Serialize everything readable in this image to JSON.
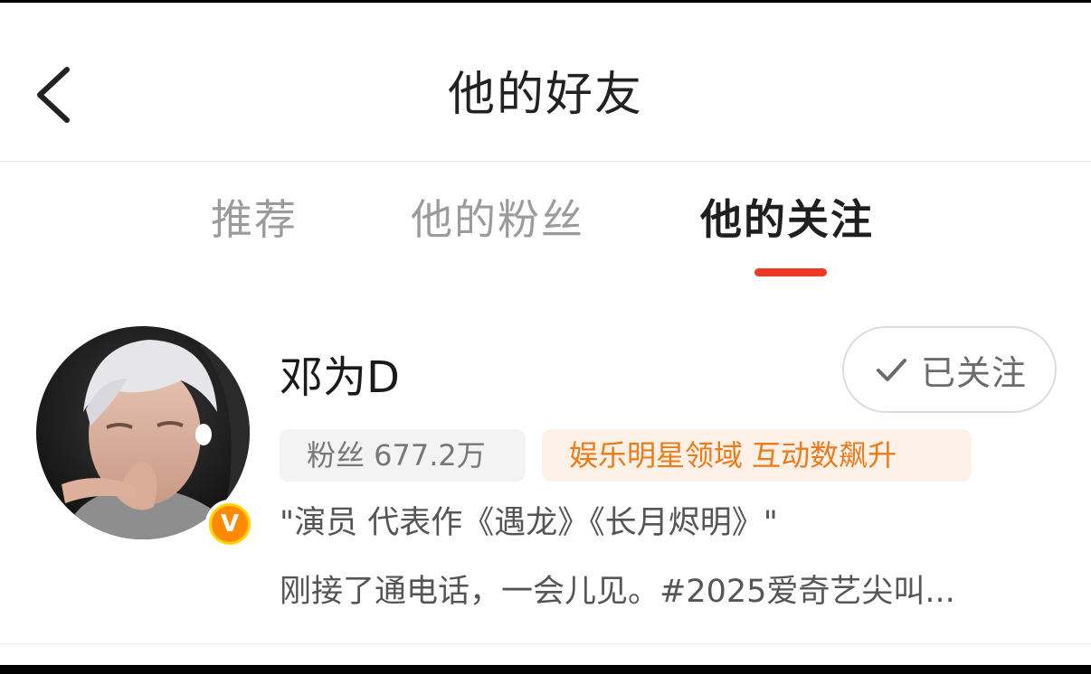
{
  "header": {
    "title": "他的好友",
    "back_icon": "chevron-left-icon"
  },
  "tabs": [
    {
      "label": "推荐",
      "active": false
    },
    {
      "label": "他的粉丝",
      "active": false
    },
    {
      "label": "他的关注",
      "active": true
    }
  ],
  "colors": {
    "accent": "#ee3a24",
    "hot_tag_text": "#ec7b1a",
    "hot_tag_bg": "#fdf0e6",
    "verified_badge": "#ff8a00"
  },
  "user": {
    "name": "邓为D",
    "verified_badge": "V",
    "follow_button": {
      "label": "已关注",
      "icon": "check-icon"
    },
    "fans_tag": "粉丝 677.2万",
    "hot_tag": "娱乐明星领域 互动数飙升",
    "bio": "\"演员 代表作《遇龙》《长月烬明》\"",
    "latest_post": "刚接了通电话，一会儿见。#2025爱奇艺尖叫..."
  }
}
